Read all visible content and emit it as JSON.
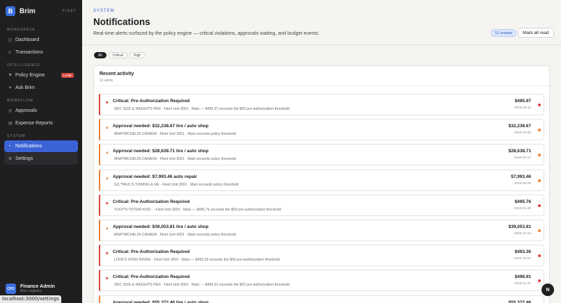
{
  "brand": {
    "name": "Brim",
    "logo_letter": "B",
    "tag": "FLEET"
  },
  "sidebar": {
    "sections": [
      "WORKSPACE",
      "INTELLIGENCE",
      "WORKFLOW",
      "SYSTEM"
    ],
    "items": [
      {
        "label": "Dashboard",
        "icon": "grid-icon"
      },
      {
        "label": "Transactions",
        "icon": "list-icon"
      },
      {
        "label": "Policy Engine",
        "icon": "flag-icon",
        "badge": "LIVE"
      },
      {
        "label": "Ask Brim",
        "icon": "sparkle-icon"
      },
      {
        "label": "Approvals",
        "icon": "check-circle-icon"
      },
      {
        "label": "Expense Reports",
        "icon": "report-icon"
      },
      {
        "label": "Notifications",
        "icon": "bell-icon"
      },
      {
        "label": "Settings",
        "icon": "gear-icon"
      }
    ]
  },
  "user": {
    "initials": "CFO",
    "name": "Finance Admin",
    "sub": "Brim Logistics"
  },
  "status_url": "localhost:3000/settings",
  "header": {
    "eyebrow": "SYSTEM",
    "title": "Notifications",
    "subtitle": "Real-time alerts surfaced by the policy engine — critical violations, approvals waiting, and budget events.",
    "unread": "12 unread",
    "mark_all": "Mark all read"
  },
  "filters": [
    "All",
    "Critical",
    "High"
  ],
  "panel": {
    "title": "Recent activity",
    "count": "12 alerts"
  },
  "colors": {
    "critical": "#d9453b",
    "high": "#e8823a",
    "accent": "#3b63d6"
  },
  "alerts": [
    {
      "level": "critical",
      "title": "Critical: Pre-Authorization Required",
      "detail": "OKC SIZE & WEIGHTS PER · Fleet Unit 3001 · Main — $495.97 exceeds the $50 pre-authorization threshold",
      "amount": "$495.97",
      "date": "2026-03-11"
    },
    {
      "level": "high",
      "title": "Approval needed: $32,238.67 tire / auto shop",
      "detail": "MNA*MICHELIN CANADA · Fleet Unit 3001 · Main exceeds policy threshold",
      "amount": "$32,238.67",
      "date": "2026-03-06"
    },
    {
      "level": "high",
      "title": "Approval needed: $28,638.71 tire / auto shop",
      "detail": "MNA*MICHELIN CANADA · Fleet Unit 3001 · Main exceeds policy threshold",
      "amount": "$28,638.71",
      "date": "2026-02-17"
    },
    {
      "level": "high",
      "title": "Approval needed: $7,993.46 auto repair",
      "detail": "SQ *PAUL'S TOWING & RE · Fleet Unit 3001 · Main exceeds policy threshold",
      "amount": "$7,993.46",
      "date": "2026-02-02"
    },
    {
      "level": "critical",
      "title": "Critical: Pre-Authorization Required",
      "detail": "TOOT'N TOTUM #100 - · Fleet Unit 3001 · Main — $495.76 exceeds the $50 pre-authorization threshold",
      "amount": "$495.76",
      "date": "2026-01-08"
    },
    {
      "level": "high",
      "title": "Approval needed: $39,053.81 tire / auto shop",
      "detail": "MNA*MICHELIN CANADA · Fleet Unit 3001 · Main exceeds policy threshold",
      "amount": "$39,053.81",
      "date": "2025-12-16"
    },
    {
      "level": "critical",
      "title": "Critical: Pre-Authorization Required",
      "detail": "LOVE'S #0336 INSIDE · Fleet Unit 3001 · Main — $493.36 exceeds the $50 pre-authorization threshold",
      "amount": "$493.36",
      "date": "2025-12-07"
    },
    {
      "level": "critical",
      "title": "Critical: Pre-Authorization Required",
      "detail": "OKC SIZE & WEIGHTS PER · Fleet Unit 3001 · Main — $498.91 exceeds the $50 pre-authorization threshold",
      "amount": "$498.91",
      "date": "2025-11-21"
    },
    {
      "level": "high",
      "title": "Approval needed: $55,372.46 tire / auto shop",
      "detail": "",
      "amount": "$55,372.46",
      "date": ""
    }
  ],
  "fab_label": "N"
}
